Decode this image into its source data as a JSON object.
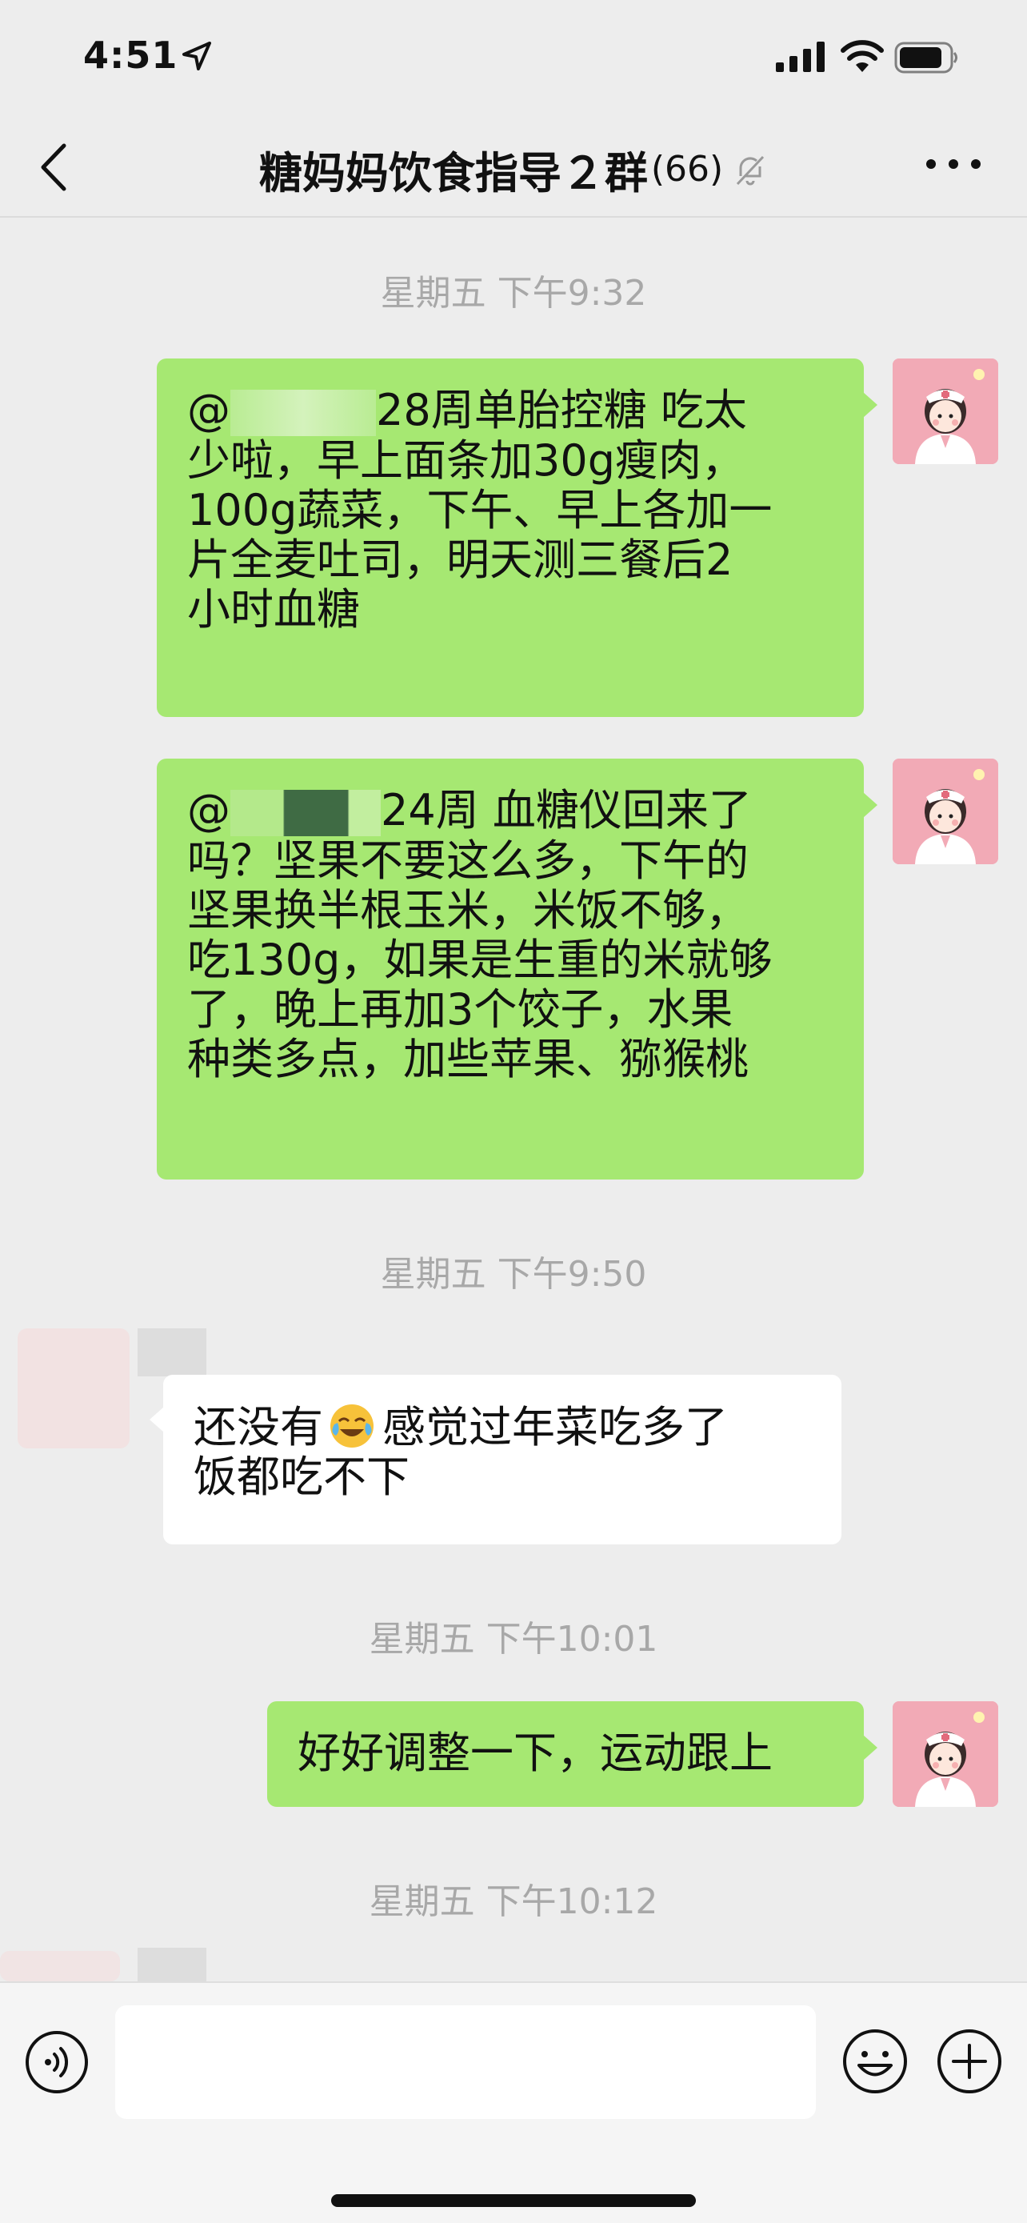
{
  "status_bar": {
    "time": "4:51",
    "icons": [
      "location-arrow-icon",
      "cellular-signal-icon",
      "wifi-icon",
      "battery-icon"
    ]
  },
  "nav": {
    "title": "糖妈妈饮食指导２群",
    "member_count": "(66)",
    "icons": [
      "back-chevron-icon",
      "mute-bell-icon",
      "more-dots-icon"
    ]
  },
  "messages": [
    {
      "type": "timestamp",
      "text": "星期五 下午9:32"
    },
    {
      "type": "outgoing",
      "lines": [
        "@",
        "28周单胎控糖 吃太",
        "少啦，早上面条加30g瘦肉，",
        "100g蔬菜，下午、早上各加一",
        "片全麦吐司，明天测三餐后2",
        "小时血糖"
      ]
    },
    {
      "type": "outgoing",
      "lines": [
        "@",
        "24周 血糖仪回来了",
        "吗？坚果不要这么多，下午的",
        "坚果换半根玉米，米饭不够，",
        "吃130g，如果是生重的米就够",
        "了，晚上再加3个饺子，水果",
        "种类多点，加些苹果、猕猴桃"
      ]
    },
    {
      "type": "timestamp",
      "text": "星期五 下午9:50"
    },
    {
      "type": "incoming",
      "text_before_emoji": "还没有",
      "emoji": "crying-laughing-emoji",
      "text_after_emoji": "感觉过年菜吃多了",
      "line2": "饭都吃不下"
    },
    {
      "type": "timestamp",
      "text": "星期五 下午10:01"
    },
    {
      "type": "outgoing",
      "text": "好好调整一下，运动跟上"
    },
    {
      "type": "timestamp",
      "text": "星期五 下午10:12"
    }
  ],
  "input_bar": {
    "placeholder": "",
    "icons": [
      "voice-input-icon",
      "emoji-icon",
      "plus-icon"
    ]
  },
  "colors": {
    "background": "#ededed",
    "outgoing_bubble": "#a6e872",
    "incoming_bubble": "#ffffff",
    "timestamp_text": "#a8a8a8",
    "avatar_bg": "#f2aab6"
  }
}
